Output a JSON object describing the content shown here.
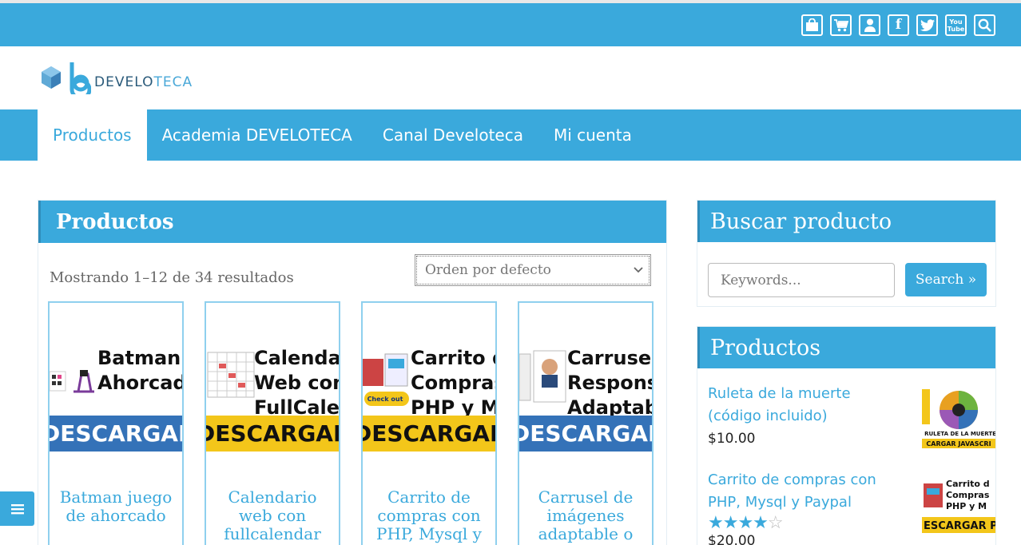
{
  "top_icons": [
    "shopping-bag-icon",
    "cart-icon",
    "user-icon",
    "facebook-icon",
    "twitter-icon",
    "youtube-icon",
    "search-icon"
  ],
  "youtube_text": "You Tube",
  "logo": {
    "text_dark": "DEVELO",
    "text_light": "TECA"
  },
  "nav": [
    "Productos",
    "Academia DEVELOTECA",
    "Canal Develoteca",
    "Mi cuenta"
  ],
  "main": {
    "title": "Productos",
    "result_count": "Mostrando 1–12 de 34 resultados",
    "orderby": "Orden por defecto"
  },
  "products": [
    {
      "thumb_text": "Batman\nAhorcad",
      "band_text": "DESCARGAR",
      "band_color": "blue",
      "title": "Batman juego de ahorcado"
    },
    {
      "thumb_text": "Calendar\nWeb con\nFullCaler",
      "band_text": "DESCARGAR P",
      "band_color": "yellow",
      "title": "Calendario web con fullcalendar"
    },
    {
      "thumb_text": "Carrito d\nCompras\nPHP y My",
      "band_text": "DESCARGAR P",
      "band_color": "yellow",
      "title": "Carrito de compras con PHP, Mysql y"
    },
    {
      "thumb_text": "Carrusel\nRespons\nAdaptab",
      "band_text": "DESCARGAR",
      "band_color": "blue",
      "title": "Carrusel de imágenes adaptable o"
    }
  ],
  "sidebar": {
    "search_title": "Buscar producto",
    "search_placeholder": "Keywords...",
    "search_button": "Search »",
    "products_title": "Productos",
    "items": [
      {
        "title": "Ruleta de la muerte (código incluido)",
        "price": "$10.00",
        "img_top": "RULETA DE LA MUERTE",
        "img_bottom": "CARGAR JAVASCRI"
      },
      {
        "title": "Carrito de compras con PHP, Mysql y Paypal",
        "price": "$20.00",
        "rating": 4.5,
        "img_text": "Carrito d\nCompras\nPHP y M",
        "img_bottom": "ESCARGAR P"
      }
    ]
  },
  "colors": {
    "brand": "#3aa9dc",
    "band_blue": "#3472b8",
    "band_yellow": "#f3c61a"
  }
}
